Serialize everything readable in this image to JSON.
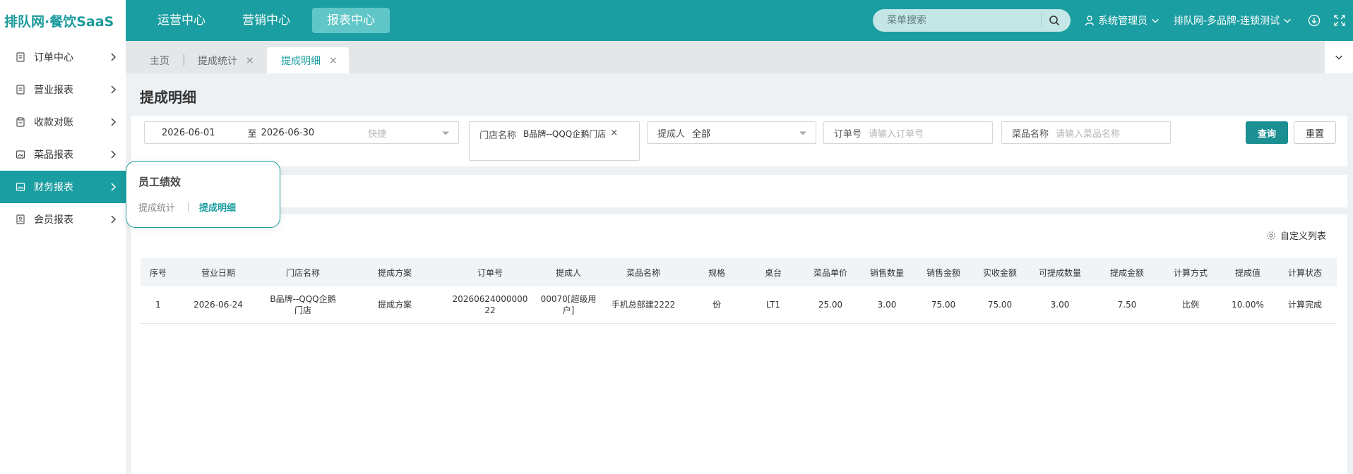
{
  "logo": {
    "text": "排队网·餐饮SaaS"
  },
  "topnav": {
    "items": [
      "运营中心",
      "营销中心",
      "报表中心"
    ],
    "active_index": 2
  },
  "search": {
    "placeholder": "菜单搜索"
  },
  "user": {
    "name": "系统管理员"
  },
  "org": {
    "name": "排队网-多品牌-连锁测试"
  },
  "sidebar": {
    "items": [
      {
        "label": "订单中心",
        "icon": "document-icon"
      },
      {
        "label": "营业报表",
        "icon": "document-icon"
      },
      {
        "label": "收款对账",
        "icon": "ledger-icon"
      },
      {
        "label": "菜品报表",
        "icon": "picture-icon"
      },
      {
        "label": "财务报表",
        "icon": "picture-icon"
      },
      {
        "label": "会员报表",
        "icon": "member-icon"
      }
    ],
    "active_index": 4
  },
  "tabs": {
    "home": "主页",
    "items": [
      {
        "label": "提成统计",
        "close": "×"
      },
      {
        "label": "提成明细",
        "close": "×"
      }
    ],
    "active_index": 1
  },
  "page": {
    "title": "提成明细"
  },
  "filters": {
    "date_start": "2026-06-01",
    "date_to": "至",
    "date_end": "2026-06-30",
    "quick": "快捷",
    "store_label": "门店名称",
    "store_value": "B品牌--QQQ企鹅门店",
    "store_clear": "×",
    "person_label": "提成人",
    "person_value": "全部",
    "order_label": "订单号",
    "order_placeholder": "请输入订单号",
    "dish_label": "菜品名称",
    "dish_placeholder": "请输入菜品名称",
    "query_button": "查询",
    "reset_button": "重置"
  },
  "custom_columns": "自定义列表",
  "table": {
    "headers": [
      "序号",
      "营业日期",
      "门店名称",
      "提成方案",
      "订单号",
      "提成人",
      "菜品名称",
      "规格",
      "桌台",
      "菜品单价",
      "销售数量",
      "销售金额",
      "实收金额",
      "可提成数量",
      "提成金额",
      "计算方式",
      "提成值",
      "计算状态"
    ],
    "rows": [
      {
        "seq": "1",
        "date": "2026-06-24",
        "store_line1": "B品牌--QQQ企鹅",
        "store_line2": "门店",
        "scheme": "提成方案",
        "order_line1": "20260624000000",
        "order_line2": "22",
        "person_line1": "00070[超级用",
        "person_line2": "户]",
        "dish": "手机总部建2222",
        "spec": "份",
        "table_no": "LT1",
        "unit_price": "25.00",
        "qty": "3.00",
        "sales_amount": "75.00",
        "paid_amount": "75.00",
        "commission_qty": "3.00",
        "commission_amount": "7.50",
        "calc_method": "比例",
        "commission_value": "10.00%",
        "calc_status": "计算完成"
      }
    ]
  },
  "popover": {
    "title": "员工绩效",
    "links": [
      "提成统计",
      "提成明细"
    ],
    "active_index": 1
  },
  "colors": {
    "primary": "#1b9ea1",
    "nav_active": "#60c6c7",
    "query_button": "#1b8f92"
  }
}
